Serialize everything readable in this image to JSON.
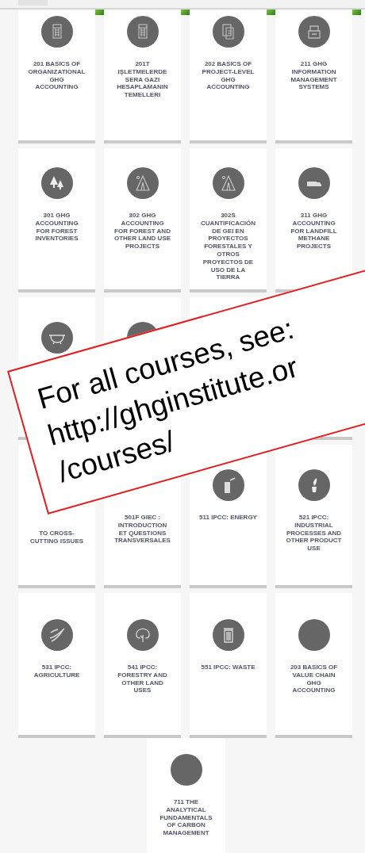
{
  "course_rows": [
    {
      "cards": [
        {
          "kind": "calculator",
          "thumbnail": true,
          "title_lines": [
            "201 BASICS OF",
            "ORGANIZATIONAL",
            "GHG",
            "ACCOUNTING"
          ]
        },
        {
          "kind": "calculator",
          "thumbnail": true,
          "title_lines": [
            "201T",
            "IŞLETMELERDE",
            "SERA GAZI",
            "HESAPLAMANIN",
            "TEMELLERI"
          ]
        },
        {
          "kind": "document",
          "thumbnail": true,
          "title_lines": [
            "202 BASICS OF",
            "PROJECT-LEVEL",
            "GHG",
            "ACCOUNTING"
          ]
        },
        {
          "kind": "box",
          "thumbnail": true,
          "title_lines": [
            "211 GHG",
            "INFORMATION",
            "MANAGEMENT",
            "SYSTEMS"
          ]
        }
      ]
    },
    {
      "cards": [
        {
          "kind": "trees",
          "title_lines": [
            "301 GHG",
            "ACCOUNTING",
            "FOR FOREST",
            "INVENTORIES"
          ]
        },
        {
          "kind": "mountain",
          "title_lines": [
            "302 GHG",
            "ACCOUNTING",
            "FOR FOREST AND",
            "OTHER LAND USE",
            "PROJECTS"
          ]
        },
        {
          "kind": "mountain",
          "title_lines": [
            "302S",
            "CUANTIFICACIÓN",
            "DE GEI EN",
            "PROYECTOS",
            "FORESTALES Y",
            "OTROS",
            "PROYECTOS DE",
            "USO DE LA",
            "TIERRA"
          ]
        },
        {
          "kind": "truck",
          "title_lines": [
            "311 GHG",
            "ACCOUNTING",
            "FOR LANDFILL",
            "METHANE",
            "PROJECTS"
          ]
        }
      ]
    },
    {
      "cards": [
        {
          "kind": "pot"
        },
        {
          "kind": "car"
        },
        {
          "kind": "covered"
        },
        {
          "kind": "covered"
        }
      ]
    },
    {
      "cards": [
        {
          "kind": "covered",
          "partly_covered": true,
          "title_lines": [
            "TO CROSS-",
            "CUTTING ISSUES"
          ]
        },
        {
          "kind": "covered",
          "title_lines": [
            "501F GIEC :",
            "INTRODUCTION",
            "ET QUESTIONS",
            "TRANSVERSALES"
          ]
        },
        {
          "kind": "building",
          "title_lines": [
            "511 IPCC: ENERGY"
          ]
        },
        {
          "kind": "plant",
          "title_lines": [
            "521 IPCC:",
            "INDUSTRIAL",
            "PROCESSES AND",
            "OTHER PRODUCT",
            "USE"
          ]
        }
      ]
    },
    {
      "cards": [
        {
          "kind": "field",
          "title_lines": [
            "531 IPCC:",
            "AGRICULTURE"
          ]
        },
        {
          "kind": "tree",
          "title_lines": [
            "541 IPCC:",
            "FORESTRY AND",
            "OTHER LAND",
            "USES"
          ]
        },
        {
          "kind": "trash",
          "title_lines": [
            "551 IPCC: WASTE"
          ]
        },
        {
          "kind": "blank",
          "title_lines": [
            "203 BASICS OF",
            "VALUE CHAIN",
            "GHG",
            "ACCOUNTING"
          ]
        }
      ]
    },
    {
      "cards": [
        {
          "kind": "blank",
          "title_lines": [
            "711 THE",
            "ANALYTICAL",
            "FUNDAMENTALS",
            "OF CARBON",
            "MANAGEMENT"
          ]
        }
      ]
    }
  ],
  "callout": {
    "lines": [
      "For all courses, see:",
      "http://ghginstitute.or",
      "/courses/"
    ]
  }
}
